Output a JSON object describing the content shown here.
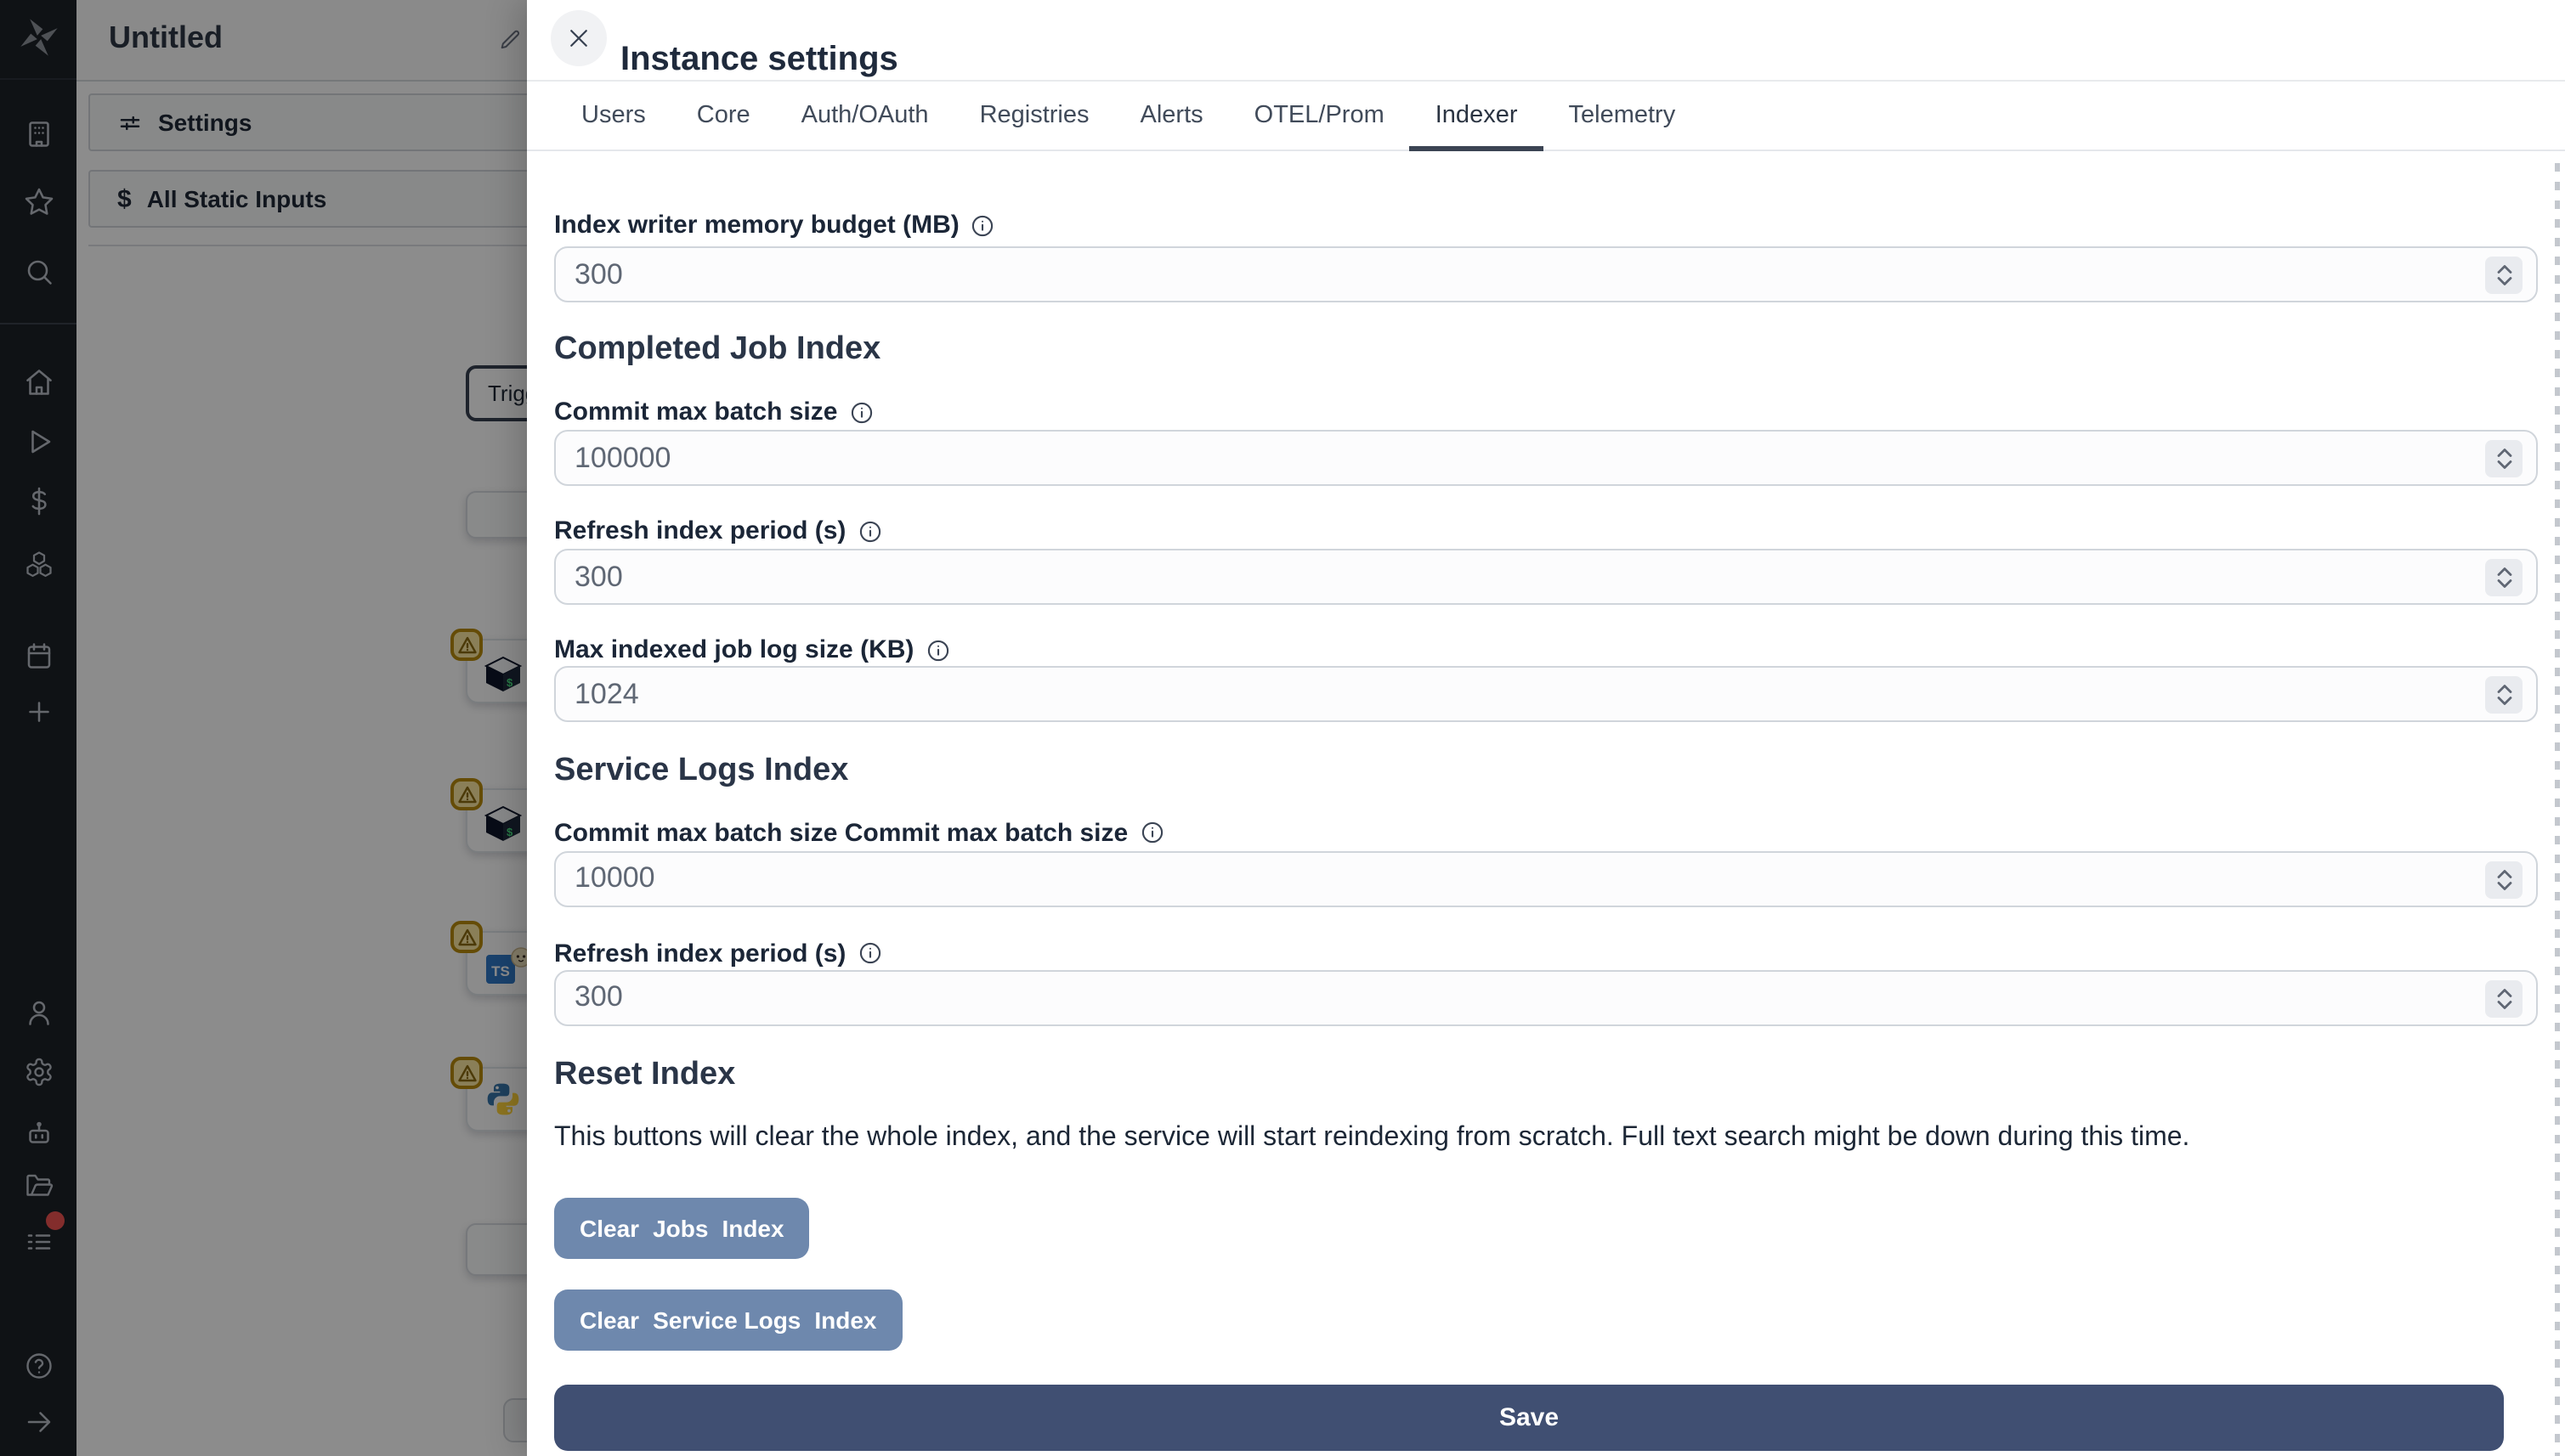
{
  "sidebar": {
    "icons_top": [
      "windmill-logo",
      "company",
      "favorites",
      "search"
    ],
    "icons_middle": [
      "home",
      "runs",
      "variables",
      "resources",
      "schedules",
      "add"
    ],
    "icons_bottom": [
      "user",
      "instance-settings",
      "ai",
      "folders",
      "audit-logs"
    ],
    "icons_footer": [
      "help",
      "expand"
    ],
    "notification_color": "#ef5350"
  },
  "panel": {
    "title": "Untitled",
    "rows": [
      {
        "label": "Settings"
      },
      {
        "label": "All Static Inputs"
      }
    ],
    "flow": {
      "trigger_label": "Triggers",
      "node_icons": [
        "bash-cube",
        "bash-cube",
        "typescript-bun",
        "python"
      ]
    }
  },
  "modal": {
    "title": "Instance settings",
    "tabs": [
      {
        "label": "Users"
      },
      {
        "label": "Core"
      },
      {
        "label": "Auth/OAuth"
      },
      {
        "label": "Registries"
      },
      {
        "label": "Alerts"
      },
      {
        "label": "OTEL/Prom"
      },
      {
        "label": "Indexer"
      },
      {
        "label": "Telemetry"
      }
    ],
    "active_tab": "Indexer",
    "fields": [
      {
        "label": "Index writer memory budget (MB)",
        "value": "300"
      },
      {
        "label": "Commit max batch size",
        "value": "100000"
      },
      {
        "label": "Refresh index period (s)",
        "value": "300"
      },
      {
        "label": "Max indexed job log size (KB)",
        "value": "1024"
      },
      {
        "label": "Commit max batch size Commit max batch size",
        "value": "10000"
      },
      {
        "label": "Refresh index period (s)",
        "value": "300"
      }
    ],
    "sections": [
      {
        "heading": "Completed Job Index"
      },
      {
        "heading": "Service Logs Index"
      },
      {
        "heading": "Reset Index"
      }
    ],
    "reset": {
      "description": "This buttons will clear the whole index, and the service will start reindexing from scratch. Full text search might be down during this time.",
      "clear_jobs_button": {
        "pre": "Clear",
        "em": "Jobs",
        "post": "Index"
      },
      "clear_service_logs_button": {
        "pre": "Clear",
        "em": "Service Logs",
        "post": "Index"
      }
    },
    "save_label": "Save"
  },
  "colors": {
    "save_button": "#404f72",
    "clear_button": "#6e88ad",
    "active_tab_underline": "#3b4453",
    "warning_badge_border": "#b98a0b",
    "warning_badge_bg": "#fbe7a1",
    "sidebar_bg": "#1c2127",
    "notification_red": "#ef5350",
    "overlay": "rgba(0,0,0,0.45)"
  }
}
